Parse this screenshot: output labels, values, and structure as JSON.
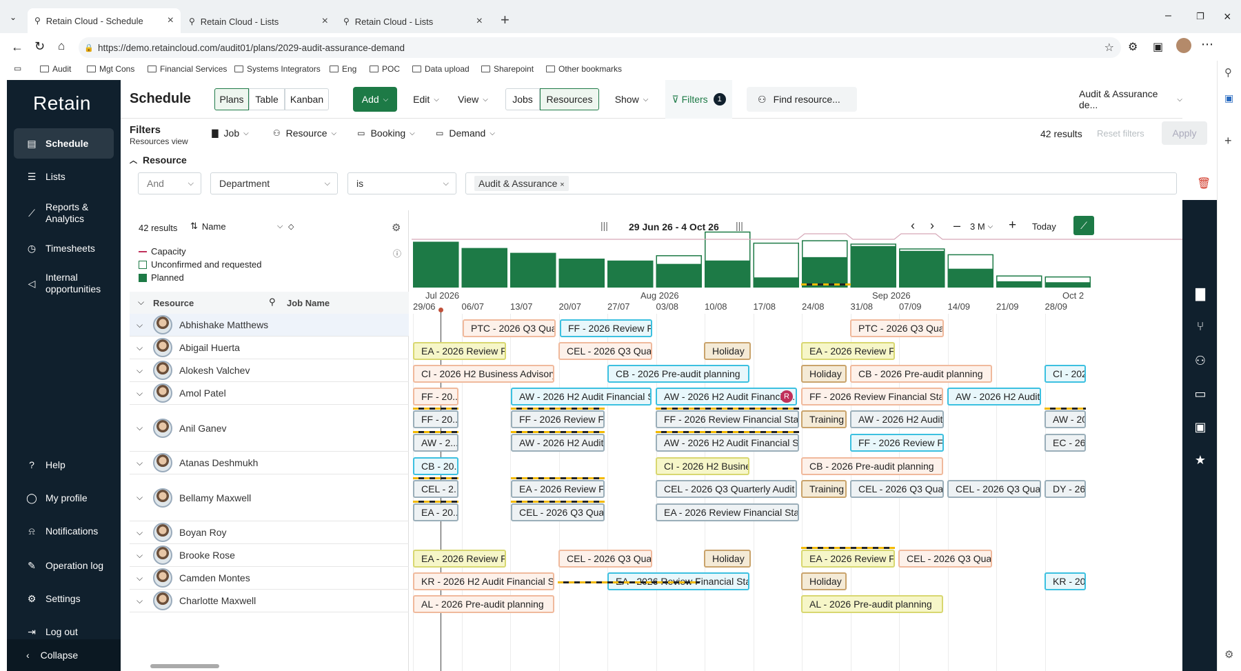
{
  "browser": {
    "tabs": [
      {
        "label": "Retain Cloud - Schedule",
        "active": true
      },
      {
        "label": "Retain Cloud - Lists"
      },
      {
        "label": "Retain Cloud - Lists"
      }
    ],
    "url": "https://demo.retaincloud.com/audit01/plans/2029-audit-assurance-demand",
    "bookmarks": [
      "Audit",
      "Mgt Cons",
      "Financial Services",
      "Systems Integrators",
      "Eng",
      "POC",
      "Data upload",
      "Sharepoint",
      "Other bookmarks"
    ]
  },
  "sidebar": {
    "logo": "Retain",
    "items": [
      {
        "label": "Schedule",
        "icon": "calendar-icon"
      },
      {
        "label": "Lists",
        "icon": "list-icon"
      },
      {
        "label": "Reports & Analytics",
        "icon": "chart-icon"
      },
      {
        "label": "Timesheets",
        "icon": "clock-icon"
      },
      {
        "label": "Internal opportunities",
        "icon": "megaphone-icon"
      }
    ],
    "bottom": [
      {
        "label": "Help",
        "icon": "question-icon"
      },
      {
        "label": "My profile",
        "icon": "user-icon"
      },
      {
        "label": "Notifications",
        "icon": "bell-icon"
      },
      {
        "label": "Operation log",
        "icon": "log-icon"
      },
      {
        "label": "Settings",
        "icon": "gear-icon"
      },
      {
        "label": "Log out",
        "icon": "logout-icon"
      }
    ],
    "collapse": "Collapse"
  },
  "toolbar": {
    "title": "Schedule",
    "views": [
      "Plans",
      "Table",
      "Kanban"
    ],
    "add": "Add",
    "edit": "Edit",
    "view": "View",
    "mode": [
      "Jobs",
      "Resources"
    ],
    "show": "Show",
    "filters": "Filters",
    "filter_count": "1",
    "find": "Find resource...",
    "plan": "Audit & Assurance de..."
  },
  "filters": {
    "heading": "Filters",
    "sub": "Resources view",
    "types": [
      "Job",
      "Resource",
      "Booking",
      "Demand"
    ],
    "results": "42 results",
    "reset": "Reset filters",
    "apply": "Apply",
    "section": "Resource",
    "rule": {
      "join": "And",
      "field": "Department",
      "op": "is",
      "value": "Audit & Assurance"
    }
  },
  "grid": {
    "results": "42 results",
    "sort": "Name",
    "legend": [
      "Capacity",
      "Unconfirmed and requested",
      "Planned"
    ],
    "col_resource": "Resource",
    "col_job": "Job Name",
    "range": "29 Jun 26 - 4 Oct 26",
    "zoom": "3 M",
    "today": "Today",
    "months": [
      "Jul 2026",
      "Aug 2026",
      "Sep 2026",
      "Oct 2"
    ],
    "weeks": [
      "29/06",
      "06/07",
      "13/07",
      "20/07",
      "27/07",
      "03/08",
      "10/08",
      "17/08",
      "24/08",
      "31/08",
      "07/09",
      "14/09",
      "21/09",
      "28/09"
    ],
    "resources": [
      "Abhishake Matthews",
      "Abigail Huerta",
      "Alokesh Valchev",
      "Amol Patel",
      "Anil Ganev",
      "Atanas Deshmukh",
      "Bellamy Maxwell",
      "Boyan Roy",
      "Brooke Rose",
      "Camden Montes",
      "Charlotte Maxwell"
    ],
    "bars": [
      [
        "PTC - 2026 Q3 Qua...",
        "FF - 2026 Review Fi...",
        "PTC - 2026 Q3 Qua..."
      ],
      [
        "EA - 2026 Review Fi...",
        "CEL - 2026 Q3 Quar...",
        "Holiday",
        "EA - 2026 Review Fi..."
      ],
      [
        "CI - 2026 H2 Business Advisory",
        "CB - 2026 Pre-audit planning",
        "Holiday",
        "CB - 2026 Pre-audit planning",
        "CI - 2026"
      ],
      [
        "FF - 20...",
        "AW - 2026 H2 Audit Financial Sta...",
        "AW - 2026 H2 Audit Financial ...",
        "FF - 2026 Review Financial State...",
        "AW - 2026 H2 Audit..."
      ],
      [
        "FF - 20...",
        "FF - 2026 Review Fi...",
        "FF - 2026 Review Financial State...",
        "Training",
        "AW - 2026 H2 Audit...",
        "AW - 202"
      ],
      [
        "AW - 2...",
        "AW - 2026 H2 Audit...",
        "AW - 2026 H2 Audit Financial Sta...",
        "FF - 2026 Review Fi...",
        "EC - 26 -"
      ],
      [
        "CB - 20...",
        "CI - 2026 H2 Busine...",
        "CB - 2026 Pre-audit planning"
      ],
      [
        "CEL - 2...",
        "EA - 2026 Review Fi...",
        "CEL - 2026 Q3 Quarterly Audit",
        "Training",
        "CEL - 2026 Q3 Quar...",
        "CEL - 2026 Q3 Quar...",
        "DY - 26 -"
      ],
      [
        "EA - 20...",
        "CEL - 2026 Q3 Quar...",
        "EA - 2026 Review Financial State..."
      ],
      [
        "EA - 2026 Review Fi...",
        "CEL - 2026 Q3 Quar...",
        "Holiday",
        "EA - 2026 Review Fi...",
        "CEL - 2026 Q3 Quar..."
      ],
      [
        "KR - 2026 H2 Audit Financial Stat...",
        "EA - 2026 Review Financial State...",
        "Holiday",
        "KR - 202"
      ],
      [
        "AL - 2026 Pre-audit planning",
        "AL - 2026 Pre-audit planning"
      ]
    ],
    "rbadge": "R"
  },
  "histogram": {
    "planned": [
      0.95,
      0.82,
      0.72,
      0.6,
      0.56,
      0.48,
      0.55,
      0.2,
      0.62,
      0.85,
      0.75,
      0.38,
      0.12,
      0.1
    ],
    "unconfirmed": [
      0.0,
      0.0,
      0.0,
      0.0,
      0.0,
      0.18,
      0.6,
      0.72,
      0.35,
      0.05,
      0.05,
      0.3,
      0.12,
      0.12
    ]
  }
}
